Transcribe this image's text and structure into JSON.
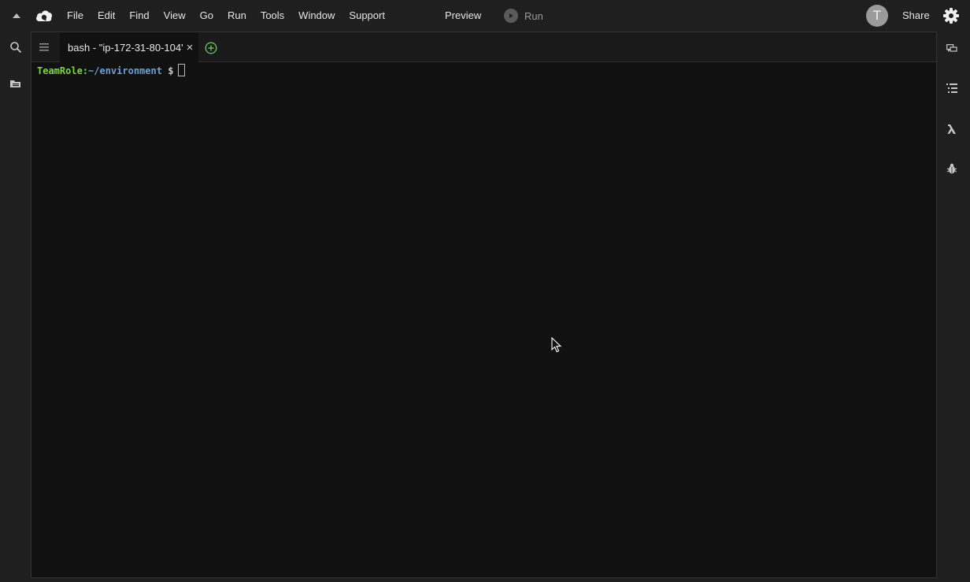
{
  "menu": [
    "File",
    "Edit",
    "Find",
    "View",
    "Go",
    "Run",
    "Tools",
    "Window",
    "Support"
  ],
  "toolbar": {
    "preview_label": "Preview",
    "run_label": "Run",
    "avatar_initial": "T",
    "share_label": "Share"
  },
  "tab": {
    "title": "bash - \"ip-172-31-80-104'",
    "close_glyph": "×"
  },
  "terminal": {
    "user": "TeamRole",
    "colon": ":",
    "path": "~/environment",
    "dollar": "$"
  },
  "icons": {
    "collapse": "caret-up-icon",
    "logo": "cloud9-logo-icon",
    "gear": "gear-icon",
    "search": "search-icon",
    "files": "folder-tree-icon",
    "tab_menu": "hamburger-icon",
    "add_tab": "plus-circle-icon",
    "collab": "chat-bubbles-icon",
    "outline": "outline-list-icon",
    "lambda": "lambda-icon",
    "debugger": "bug-icon"
  },
  "colors": {
    "prompt_user": "#7fd44a",
    "prompt_path": "#6f9fd2",
    "add_tab_icon": "#6dbd5a",
    "terminal_bg": "#111111",
    "chrome_bg": "#1f1f1f"
  }
}
